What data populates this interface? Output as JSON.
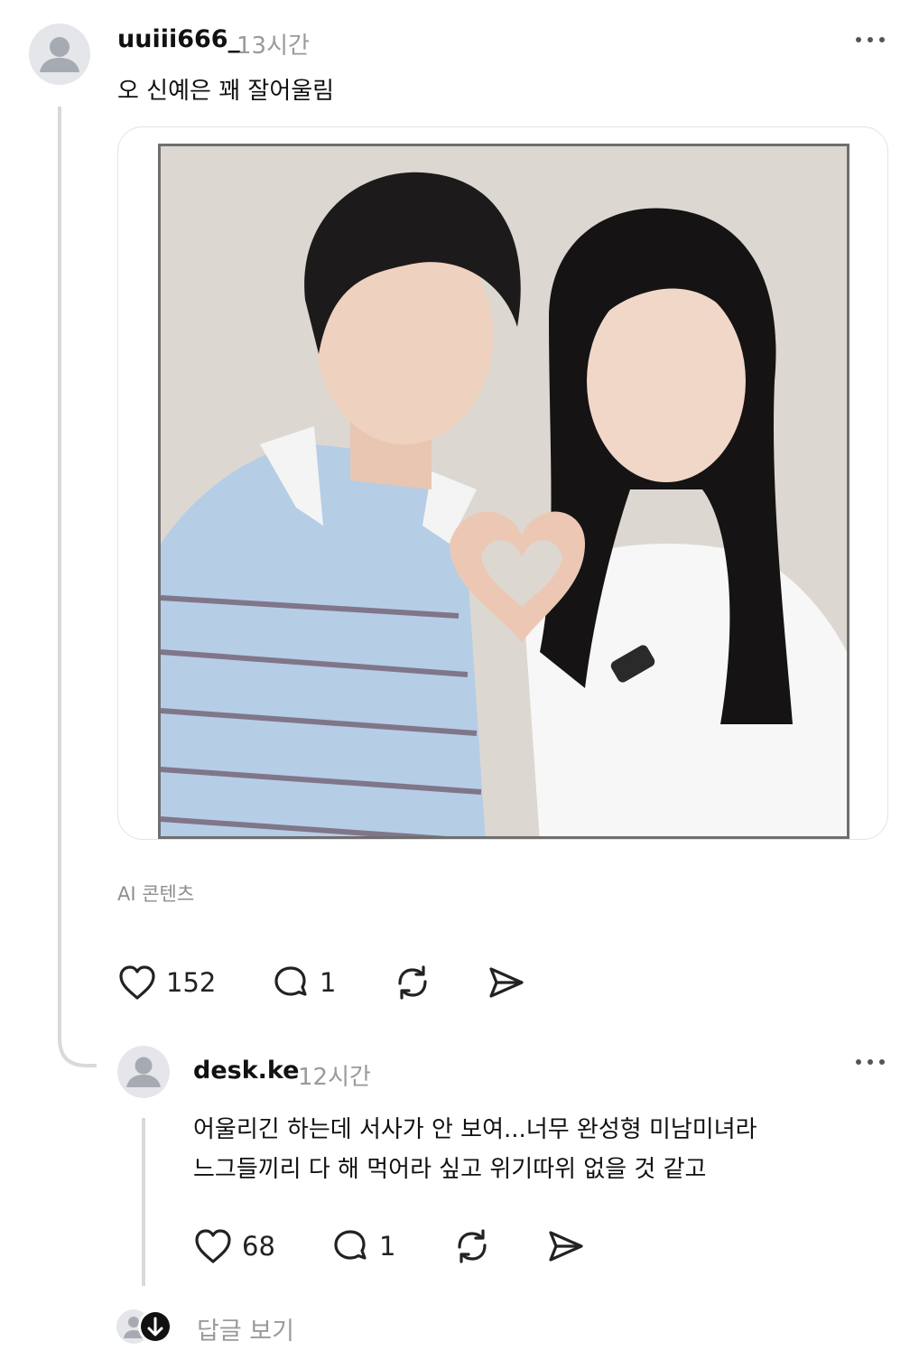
{
  "post": {
    "username": "uuiii666_",
    "timestamp": "13시간",
    "text": "오 신예은 꽤 잘어울림",
    "ai_label": "AI 콘텐츠",
    "likes": "152",
    "comments": "1",
    "icons": {
      "more": "more-horizontal-icon",
      "like": "heart-icon",
      "comment": "comment-bubble-icon",
      "repost": "repost-icon",
      "share": "send-icon"
    }
  },
  "reply": {
    "username": "desk.ke",
    "timestamp": "12시간",
    "text_lines": [
      "어울리긴 하는데 서사가 안 보여...너무 완성형 미남미녀라",
      "느그들끼리 다 해 먹어라 싶고 위기따위 없을 것 같고"
    ],
    "likes": "68",
    "comments": "1"
  },
  "view_replies_label": "답글 보기",
  "colors": {
    "muted_text": "#9a9a9a",
    "thread_line": "#d9d9d9",
    "avatar_bg": "#e4e6ea",
    "avatar_fg": "#a6abb3"
  }
}
